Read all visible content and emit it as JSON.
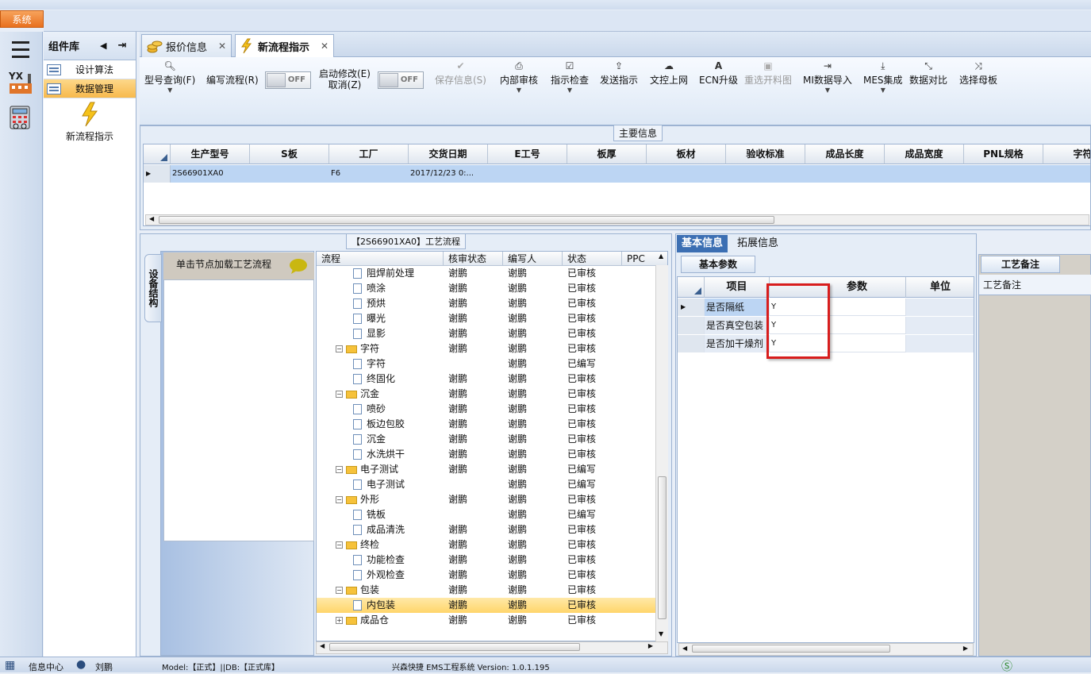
{
  "app": {
    "system_menu": "系统"
  },
  "left_rail": {
    "menu_icon": "hamburger-icon",
    "yx_icon": "yx-factory-icon",
    "calc_icon": "calculator-icon"
  },
  "component_library": {
    "title": "组件库",
    "items": [
      {
        "label": "设计算法",
        "selected": false
      },
      {
        "label": "数据管理",
        "selected": true
      }
    ],
    "shortcut_label": "新流程指示"
  },
  "tabs": [
    {
      "label": "报价信息",
      "active": false
    },
    {
      "label": "新流程指示",
      "active": true
    }
  ],
  "toolbar": {
    "model_query": "型号查询(F)",
    "edit_flow": "编写流程(R)",
    "edit_flow_toggle": "OFF",
    "auto_modify": "启动修改(E)",
    "auto_modify_sub": "取消(Z)",
    "auto_modify_toggle": "OFF",
    "save_info": "保存信息(S)",
    "internal_review": "内部审核",
    "instruction_check": "指示检查",
    "send_instruction": "发送指示",
    "upload_docs": "文控上网",
    "ecn_upgrade": "ECN升级",
    "reselect_cutting": "重选开料图",
    "mi_import": "MI数据导入",
    "mes_integration": "MES集成",
    "data_compare": "数据对比",
    "select_master": "选择母板"
  },
  "main_info": {
    "title": "主要信息",
    "columns": [
      "生产型号",
      "S板",
      "工厂",
      "交货日期",
      "E工号",
      "板厚",
      "板材",
      "验收标准",
      "成品长度",
      "成品宽度",
      "PNL规格",
      "字符"
    ],
    "rows": [
      [
        "2S66901XA0",
        "",
        "F6",
        "2017/12/23 0:...",
        "",
        "",
        "",
        "",
        "",
        "",
        "",
        ""
      ]
    ]
  },
  "process_flow": {
    "title": "【2S66901XA0】工艺流程",
    "side_tab": "设备结构",
    "node_hint": "单击节点加载工艺流程",
    "columns": [
      "流程",
      "核审状态",
      "编写人",
      "状态",
      "PPC"
    ],
    "rows": [
      {
        "name": "阻焊前处理",
        "review": "谢鹏",
        "author": "谢鹏",
        "status": "已审核",
        "level": 2,
        "folder": false,
        "selected": false
      },
      {
        "name": "喷涂",
        "review": "谢鹏",
        "author": "谢鹏",
        "status": "已审核",
        "level": 2,
        "folder": false,
        "selected": false
      },
      {
        "name": "预烘",
        "review": "谢鹏",
        "author": "谢鹏",
        "status": "已审核",
        "level": 2,
        "folder": false,
        "selected": false
      },
      {
        "name": "曝光",
        "review": "谢鹏",
        "author": "谢鹏",
        "status": "已审核",
        "level": 2,
        "folder": false,
        "selected": false
      },
      {
        "name": "显影",
        "review": "谢鹏",
        "author": "谢鹏",
        "status": "已审核",
        "level": 2,
        "folder": false,
        "selected": false
      },
      {
        "name": "字符",
        "review": "谢鹏",
        "author": "谢鹏",
        "status": "已审核",
        "level": 1,
        "folder": true,
        "selected": false
      },
      {
        "name": "字符",
        "review": "",
        "author": "谢鹏",
        "status": "已编写",
        "level": 2,
        "folder": false,
        "selected": false
      },
      {
        "name": "终固化",
        "review": "谢鹏",
        "author": "谢鹏",
        "status": "已审核",
        "level": 2,
        "folder": false,
        "selected": false
      },
      {
        "name": "沉金",
        "review": "谢鹏",
        "author": "谢鹏",
        "status": "已审核",
        "level": 1,
        "folder": true,
        "selected": false
      },
      {
        "name": "喷砂",
        "review": "谢鹏",
        "author": "谢鹏",
        "status": "已审核",
        "level": 2,
        "folder": false,
        "selected": false
      },
      {
        "name": "板边包胶",
        "review": "谢鹏",
        "author": "谢鹏",
        "status": "已审核",
        "level": 2,
        "folder": false,
        "selected": false
      },
      {
        "name": "沉金",
        "review": "谢鹏",
        "author": "谢鹏",
        "status": "已审核",
        "level": 2,
        "folder": false,
        "selected": false
      },
      {
        "name": "水洗烘干",
        "review": "谢鹏",
        "author": "谢鹏",
        "status": "已审核",
        "level": 2,
        "folder": false,
        "selected": false
      },
      {
        "name": "电子测试",
        "review": "谢鹏",
        "author": "谢鹏",
        "status": "已编写",
        "level": 1,
        "folder": true,
        "selected": false
      },
      {
        "name": "电子测试",
        "review": "",
        "author": "谢鹏",
        "status": "已编写",
        "level": 2,
        "folder": false,
        "selected": false
      },
      {
        "name": "外形",
        "review": "谢鹏",
        "author": "谢鹏",
        "status": "已审核",
        "level": 1,
        "folder": true,
        "selected": false
      },
      {
        "name": "铣板",
        "review": "",
        "author": "谢鹏",
        "status": "已编写",
        "level": 2,
        "folder": false,
        "selected": false
      },
      {
        "name": "成品清洗",
        "review": "谢鹏",
        "author": "谢鹏",
        "status": "已审核",
        "level": 2,
        "folder": false,
        "selected": false
      },
      {
        "name": "终检",
        "review": "谢鹏",
        "author": "谢鹏",
        "status": "已审核",
        "level": 1,
        "folder": true,
        "selected": false
      },
      {
        "name": "功能检查",
        "review": "谢鹏",
        "author": "谢鹏",
        "status": "已审核",
        "level": 2,
        "folder": false,
        "selected": false
      },
      {
        "name": "外观检查",
        "review": "谢鹏",
        "author": "谢鹏",
        "status": "已审核",
        "level": 2,
        "folder": false,
        "selected": false
      },
      {
        "name": "包装",
        "review": "谢鹏",
        "author": "谢鹏",
        "status": "已审核",
        "level": 1,
        "folder": true,
        "selected": false
      },
      {
        "name": "内包装",
        "review": "谢鹏",
        "author": "谢鹏",
        "status": "已审核",
        "level": 2,
        "folder": false,
        "selected": true
      },
      {
        "name": "成品仓",
        "review": "谢鹏",
        "author": "谢鹏",
        "status": "已审核",
        "level": 1,
        "folder": true,
        "selected": false
      }
    ]
  },
  "info_panel": {
    "tabs": [
      "基本信息",
      "拓展信息"
    ],
    "sub_tab": "基本参数",
    "columns": [
      "项目",
      "参数",
      "单位"
    ],
    "rows": [
      {
        "item": "是否隔纸",
        "value": "Y",
        "unit": ""
      },
      {
        "item": "是否真空包装",
        "value": "Y",
        "unit": ""
      },
      {
        "item": "是否加干燥剂",
        "value": "Y",
        "unit": ""
      }
    ]
  },
  "notes_panel": {
    "tab": "工艺备注",
    "header": "工艺备注"
  },
  "status_bar": {
    "info_center": "信息中心",
    "user": "刘鹏",
    "model_db": "Model:【正式】||DB:【正式库】",
    "version": "兴森快捷 EMS工程系统 Version: 1.0.1.195"
  },
  "colors": {
    "selection": "#ffd56a",
    "accent": "#3c6fb3",
    "highlight_box": "#d81d1d"
  }
}
